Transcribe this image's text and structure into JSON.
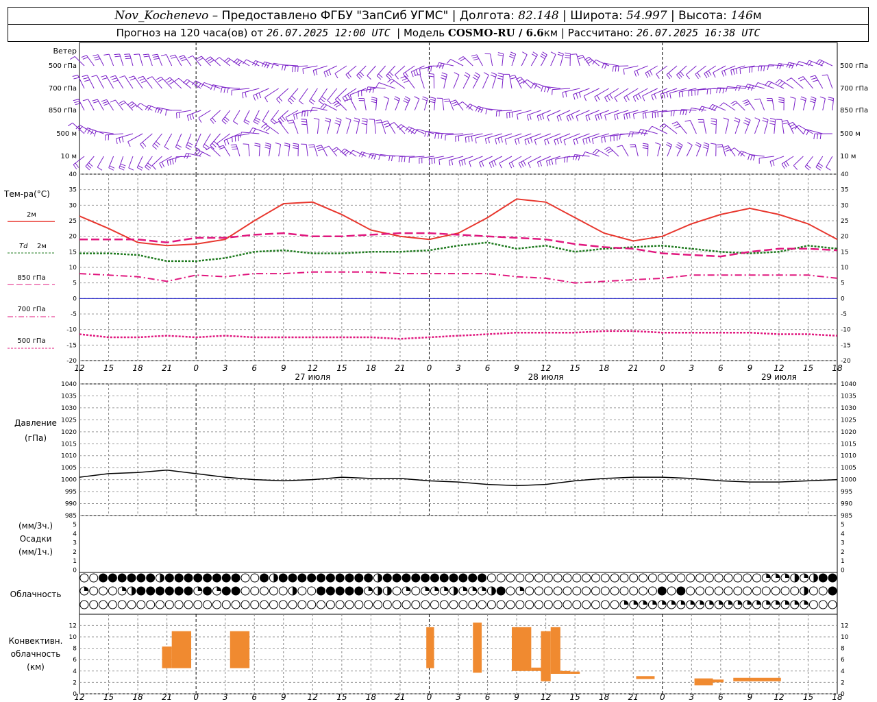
{
  "header": {
    "station": "Nov_Kochenevo",
    "provider": " – Предоставлено ФГБУ \"ЗапСиб УГМС\" | Долгота: ",
    "lon": "82.148",
    "lat_label": " | Широта: ",
    "lat": "54.997",
    "alt_label": " | Высота: ",
    "alt": "146",
    "alt_unit": "м",
    "fc_label": "Прогноз на 120 часа(ов) от ",
    "fc_time": "26.07.2025 12:00 UTC",
    "model_label": "  | Модель ",
    "model": "COSMO-RU / 6.6",
    "model_unit": "км",
    "calc_label": " | Рассчитано: ",
    "calc_time": "26.07.2025 16:38 UTC"
  },
  "labels": {
    "wind": "Ветер",
    "wind_levels": [
      "500 гПа",
      "700 гПа",
      "850 гПа",
      "500 м",
      "10 м"
    ],
    "temp": "Тем-ра(°C)",
    "t2m": "2м",
    "td": "Td",
    "td2m": "2м",
    "t850": "850 гПа",
    "t700": "700 гПа",
    "t500": "500 гПа",
    "pressure": "Давление",
    "pressure_unit": "(гПа)",
    "precip_3h": "(мм/3ч.)",
    "precip": "Осадки",
    "precip_1h": "(мм/1ч.)",
    "cloud": "Облачность",
    "conv1": "Конвективн.",
    "conv2": "облачность",
    "conv3": "(км)"
  },
  "colors": {
    "t2m": "#e8372e",
    "td": "#1e7a1e",
    "t850": "#e0177e",
    "t700": "#e0177e",
    "t500": "#e0177e",
    "wind": "#7a1fc8",
    "pressure": "#000000",
    "conv": "#f08a30",
    "zero": "#3333cc"
  },
  "axis": {
    "hour_ticks": [
      "12",
      "15",
      "18",
      "21",
      "0",
      "3",
      "6",
      "9",
      "12",
      "15",
      "18",
      "21",
      "0",
      "3",
      "6",
      "9",
      "12",
      "15",
      "18",
      "21",
      "0",
      "3",
      "6",
      "9",
      "12",
      "15",
      "18"
    ],
    "days": [
      "27 июля",
      "28 июля",
      "29 июля"
    ],
    "temp_ticks": [
      "40",
      "35",
      "30",
      "25",
      "20",
      "15",
      "10",
      "5",
      "0",
      "-5",
      "-10",
      "-15",
      "-20"
    ],
    "press_ticks": [
      "1040",
      "1035",
      "1030",
      "1025",
      "1020",
      "1015",
      "1010",
      "1005",
      "1000",
      "995",
      "990",
      "985"
    ],
    "precip_ticks": [
      "5",
      "4",
      "3",
      "2",
      "1",
      "0"
    ],
    "conv_ticks": [
      "12",
      "10",
      "8",
      "6",
      "4",
      "2",
      "0"
    ]
  },
  "chart_data": {
    "type": "line",
    "x_hours_from_start": "0..78 (26.07 12 UTC .. 29.07 18 UTC)",
    "temperature": {
      "ylim": [
        -20,
        40
      ],
      "series": [
        {
          "name": "2м",
          "x": [
            0,
            3,
            6,
            9,
            12,
            15,
            18,
            21,
            24,
            27,
            30,
            33,
            36,
            39,
            42,
            45,
            48,
            51,
            54,
            57,
            60,
            63,
            66,
            69,
            72,
            75,
            78
          ],
          "values": [
            26.5,
            22.5,
            18,
            17,
            17.5,
            19,
            25,
            30.5,
            31,
            27,
            22,
            20,
            19,
            21,
            26,
            32,
            31,
            26,
            21,
            18.5,
            20,
            24,
            27,
            29,
            27,
            24,
            19
          ]
        },
        {
          "name": "Td 2м",
          "x": [
            0,
            3,
            6,
            9,
            12,
            15,
            18,
            21,
            24,
            27,
            30,
            33,
            36,
            39,
            42,
            45,
            48,
            51,
            54,
            57,
            60,
            63,
            66,
            69,
            72,
            75,
            78
          ],
          "values": [
            14.5,
            14.5,
            14,
            12,
            12,
            13,
            15,
            15.5,
            14.5,
            14.5,
            15,
            15,
            15.5,
            17,
            18,
            16,
            17,
            15,
            16,
            16.5,
            17,
            16,
            15,
            14.5,
            15,
            17,
            16
          ]
        },
        {
          "name": "850 гПа",
          "x": [
            0,
            3,
            6,
            9,
            12,
            15,
            18,
            21,
            24,
            27,
            30,
            33,
            36,
            39,
            42,
            45,
            48,
            51,
            54,
            57,
            60,
            63,
            66,
            69,
            72,
            75,
            78
          ],
          "values": [
            19,
            19,
            19,
            18,
            19.5,
            19.5,
            20.5,
            21,
            20,
            20,
            20.5,
            21,
            21,
            20.5,
            20,
            19.5,
            19,
            17.5,
            16.5,
            16,
            14.5,
            14,
            13.5,
            15,
            16,
            16,
            15.5
          ]
        },
        {
          "name": "700 гПа",
          "x": [
            0,
            3,
            6,
            9,
            12,
            15,
            18,
            21,
            24,
            27,
            30,
            33,
            36,
            39,
            42,
            45,
            48,
            51,
            54,
            57,
            60,
            63,
            66,
            69,
            72,
            75,
            78
          ],
          "values": [
            8,
            7.5,
            7,
            5.5,
            7.5,
            7,
            8,
            8,
            8.5,
            8.5,
            8.5,
            8,
            8,
            8,
            8,
            7,
            6.5,
            5,
            5.5,
            6,
            6.5,
            7.5,
            7.5,
            7.5,
            7.5,
            7.5,
            6.5
          ]
        },
        {
          "name": "500 гПа",
          "x": [
            0,
            3,
            6,
            9,
            12,
            15,
            18,
            21,
            24,
            27,
            30,
            33,
            36,
            39,
            42,
            45,
            48,
            51,
            54,
            57,
            60,
            63,
            66,
            69,
            72,
            75,
            78
          ],
          "values": [
            -11.5,
            -12.5,
            -12.5,
            -12,
            -12.5,
            -12,
            -12.5,
            -12.5,
            -12.5,
            -12.5,
            -12.5,
            -13,
            -12.5,
            -12,
            -11.5,
            -11,
            -11,
            -11,
            -10.5,
            -10.5,
            -11,
            -11,
            -11,
            -11,
            -11.5,
            -11.5,
            -12
          ]
        }
      ]
    },
    "pressure": {
      "ylim": [
        985,
        1040
      ],
      "x": [
        0,
        3,
        6,
        9,
        12,
        15,
        18,
        21,
        24,
        27,
        30,
        33,
        36,
        39,
        42,
        45,
        48,
        51,
        54,
        57,
        60,
        63,
        66,
        69,
        72,
        75,
        78
      ],
      "values": [
        1001,
        1002.5,
        1003,
        1004,
        1002.5,
        1001,
        1000,
        999.5,
        1000,
        1001,
        1000.5,
        1000.5,
        999.5,
        999,
        998,
        997.5,
        998,
        999.5,
        1000.5,
        1001,
        1001,
        1000.5,
        999.5,
        999,
        999,
        999.5,
        1000
      ]
    },
    "cloud_rows": [
      "odffffffhffffffffoofhffffffffffhfffffffffffoooooooooooooooooooooooooooooqqqhqhff",
      "qoooqhffffffqfqffooooohoofffffqhhoqoqqqhqqqhfoqoooooooooooooofofoooooooooooohoof",
      "oooooooooooooooooooooooooooooooooooooooooooooooooooooooooqqqqqqqqqqqqqqqqqqqqooo"
    ],
    "convective_km": [
      {
        "x0": 8.5,
        "x1": 9.5,
        "bottom": 4.5,
        "top": 8.3
      },
      {
        "x0": 9.5,
        "x1": 11.5,
        "bottom": 4.5,
        "top": 11
      },
      {
        "x0": 15.5,
        "x1": 17.5,
        "bottom": 4.5,
        "top": 11
      },
      {
        "x0": 35.7,
        "x1": 36.5,
        "bottom": 4.5,
        "top": 11.7
      },
      {
        "x0": 40.5,
        "x1": 41.4,
        "bottom": 3.7,
        "top": 12.5
      },
      {
        "x0": 44.5,
        "x1": 46.5,
        "bottom": 4,
        "top": 11.7
      },
      {
        "x0": 46.5,
        "x1": 47.5,
        "bottom": 4,
        "top": 4.6
      },
      {
        "x0": 47.5,
        "x1": 48.5,
        "bottom": 2.2,
        "top": 11
      },
      {
        "x0": 48.5,
        "x1": 49.5,
        "bottom": 3.5,
        "top": 11.7
      },
      {
        "x0": 49.5,
        "x1": 50.5,
        "bottom": 3.5,
        "top": 4
      },
      {
        "x0": 50.5,
        "x1": 51.5,
        "bottom": 3.5,
        "top": 3.9
      },
      {
        "x0": 57.3,
        "x1": 59.2,
        "bottom": 2.6,
        "top": 3.1
      },
      {
        "x0": 63.3,
        "x1": 65.2,
        "bottom": 1.5,
        "top": 2.7
      },
      {
        "x0": 65.2,
        "x1": 66.3,
        "bottom": 2,
        "top": 2.5
      },
      {
        "x0": 67.3,
        "x1": 72.2,
        "bottom": 2.2,
        "top": 2.8
      }
    ]
  }
}
